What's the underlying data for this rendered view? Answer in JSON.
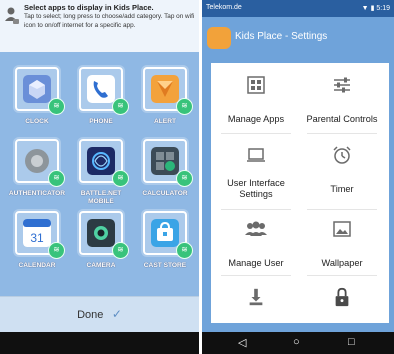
{
  "left_screen": {
    "header": {
      "title": "Select apps to display in Kids Place.",
      "subtitle": "Tap to select; long press to choose/add category. Tap on wifi icon to on/off internet for a specific app."
    },
    "apps": [
      {
        "label": "CLOCK",
        "color": "#6a8fd8"
      },
      {
        "label": "PHONE",
        "color": "#2f6fd1"
      },
      {
        "label": "ALERT",
        "color": "#f3a23c"
      },
      {
        "label": "AUTHENTICATOR",
        "color": "#8d959b"
      },
      {
        "label": "BATTLE.NET MOBILE",
        "color": "#1d2a66"
      },
      {
        "label": "CALCULATOR",
        "color": "#3c4b57"
      },
      {
        "label": "CALENDAR",
        "color": "#2f6fd1"
      },
      {
        "label": "CAMERA",
        "color": "#2c3b44"
      },
      {
        "label": "CAST STORE",
        "color": "#3aa4e6"
      }
    ],
    "done_label": "Done",
    "wifi_icon": "wifi-icon",
    "done_icon": "checkmark-icon"
  },
  "right_screen": {
    "status_bar": {
      "carrier": "Telekom.de",
      "time": "5:19"
    },
    "title": "Kids Place - Settings",
    "tiles": [
      {
        "label": "Manage Apps",
        "icon": "grid-icon"
      },
      {
        "label": "Parental Controls",
        "icon": "sliders-icon"
      },
      {
        "label": "User Interface Settings",
        "icon": "monitor-icon"
      },
      {
        "label": "Timer",
        "icon": "alarm-clock-icon"
      },
      {
        "label": "Manage User",
        "icon": "users-icon"
      },
      {
        "label": "Wallpaper",
        "icon": "image-icon"
      },
      {
        "label": "",
        "icon": "download-icon"
      },
      {
        "label": "",
        "icon": "lock-icon"
      }
    ],
    "nav": {
      "back": "◁",
      "home": "○",
      "recents": "□"
    }
  }
}
